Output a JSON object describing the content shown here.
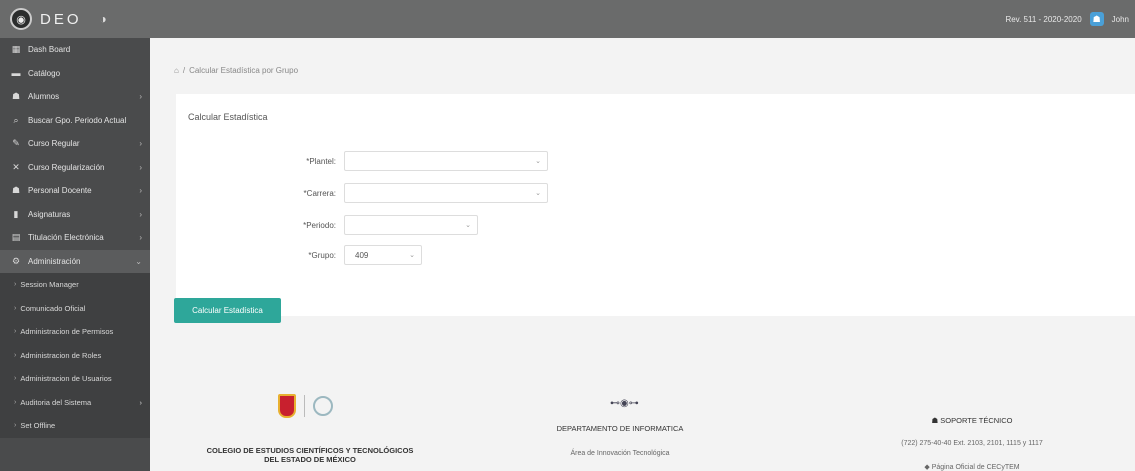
{
  "header": {
    "app_name": "DEO",
    "revision": "Rev. 511 - 2020-2020",
    "user": "John"
  },
  "sidebar": {
    "items": [
      {
        "label": "Dash Board",
        "icon": "grid-icon",
        "glyph": "▦",
        "chevron": false
      },
      {
        "label": "Catálogo",
        "icon": "folder-icon",
        "glyph": "▬",
        "chevron": false
      },
      {
        "label": "Alumnos",
        "icon": "student-icon",
        "glyph": "☗",
        "chevron": true
      },
      {
        "label": "Buscar Gpo. Periodo Actual",
        "icon": "search-icon",
        "glyph": "⌕",
        "chevron": false
      },
      {
        "label": "Curso Regular",
        "icon": "edit-icon",
        "glyph": "✎",
        "chevron": true
      },
      {
        "label": "Curso Regularización",
        "icon": "close-icon",
        "glyph": "✕",
        "chevron": true
      },
      {
        "label": "Personal Docente",
        "icon": "person-icon",
        "glyph": "☗",
        "chevron": true
      },
      {
        "label": "Asignaturas",
        "icon": "book-icon",
        "glyph": "▮",
        "chevron": true
      },
      {
        "label": "Titulación Electrónica",
        "icon": "document-icon",
        "glyph": "▤",
        "chevron": true
      },
      {
        "label": "Administración",
        "icon": "settings-icon",
        "glyph": "⚙",
        "chevron": true
      }
    ],
    "subitems": [
      {
        "label": "Session Manager",
        "chevron": false
      },
      {
        "label": "Comunicado Oficial",
        "chevron": false
      },
      {
        "label": "Administracion de Permisos",
        "chevron": false
      },
      {
        "label": "Administracion de Roles",
        "chevron": false
      },
      {
        "label": "Administracion de Usuarios",
        "chevron": false
      },
      {
        "label": "Auditoria del Sistema",
        "chevron": true
      },
      {
        "label": "Set Offline",
        "chevron": false
      }
    ]
  },
  "breadcrumb": {
    "separator": "/",
    "current": "Calcular Estadística por Grupo"
  },
  "form": {
    "title": "Calcular Estadística",
    "plantel_label": "*Plantel:",
    "plantel_value": "",
    "carrera_label": "*Carrera:",
    "carrera_value": "",
    "periodo_label": "*Periodo:",
    "periodo_value": "",
    "grupo_label": "*Grupo:",
    "grupo_value": "409",
    "submit_label": "Calcular Estadística"
  },
  "footer": {
    "institution_line1": "COLEGIO DE ESTUDIOS CIENTÍFICOS Y TECNOLÓGICOS",
    "institution_line2": "DEL ESTADO DE MÉXICO",
    "dept": "DEPARTAMENTO DE INFORMATICA",
    "area": "Área de Innovación Tecnológica",
    "support_title": "SOPORTE TÉCNICO",
    "phone": "(722) 275-40-40 Ext. 2103, 2101, 1115 y 1117",
    "page_link": "Página Oficial de CECyTEM"
  }
}
